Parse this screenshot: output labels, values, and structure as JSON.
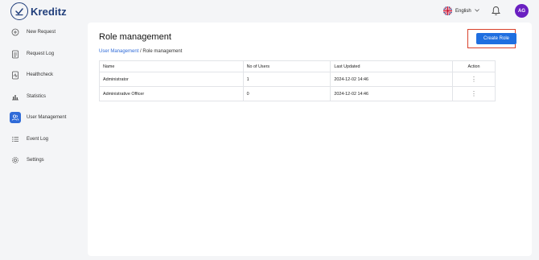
{
  "app": {
    "logo_text": "Kreditz"
  },
  "header": {
    "language": "English",
    "avatar_initials": "AG"
  },
  "sidebar": {
    "items": [
      {
        "label": "New Request",
        "icon": "plus-circle-icon"
      },
      {
        "label": "Request Log",
        "icon": "document-icon"
      },
      {
        "label": "Healthcheck",
        "icon": "health-report-icon"
      },
      {
        "label": "Statistics",
        "icon": "bar-chart-icon"
      },
      {
        "label": "User Management",
        "icon": "users-icon",
        "active": true
      },
      {
        "label": "Event Log",
        "icon": "list-icon"
      },
      {
        "label": "Settings",
        "icon": "gear-icon"
      }
    ]
  },
  "main": {
    "title": "Role management",
    "breadcrumb": {
      "parent": "User Management",
      "separator": " / ",
      "current": "Role management"
    },
    "create_button": "Create Role",
    "table": {
      "columns": [
        "Name",
        "No of Users",
        "Last Updated",
        "Action"
      ],
      "rows": [
        {
          "name": "Administrator",
          "users": "1",
          "updated": "2024-12-02 14:46"
        },
        {
          "name": "Administrative Officer",
          "users": "0",
          "updated": "2024-12-02 14:46"
        }
      ]
    }
  },
  "colors": {
    "accent": "#1f6fe0",
    "brand": "#1f3d7a",
    "avatar": "#6a1fc1",
    "highlight_border": "#d9412b"
  }
}
